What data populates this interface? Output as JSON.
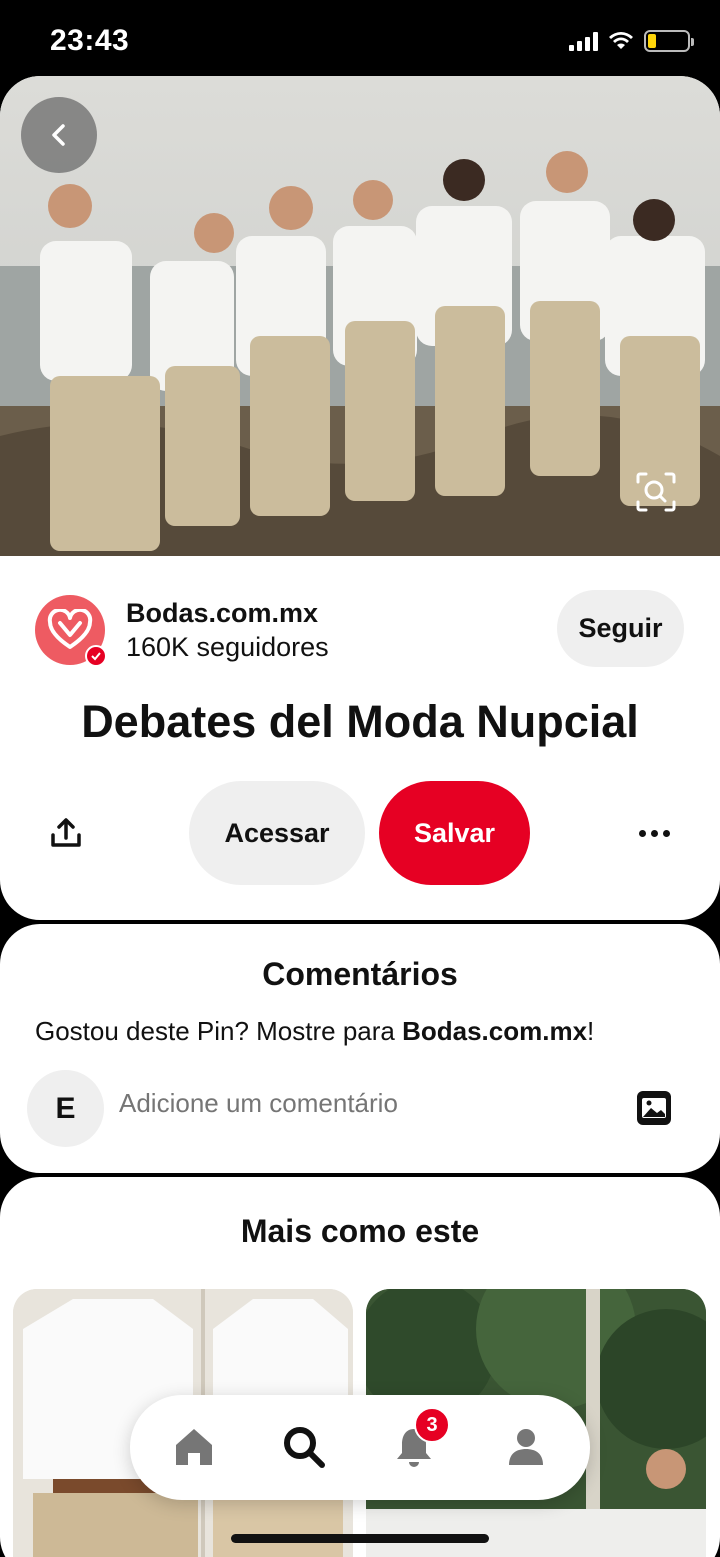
{
  "status_bar": {
    "time": "23:43"
  },
  "pin": {
    "creator": {
      "name": "Bodas.com.mx",
      "followers": "160K seguidores"
    },
    "follow_label": "Seguir",
    "title": "Debates del Moda Nupcial",
    "visit_label": "Acessar",
    "save_label": "Salvar"
  },
  "comments": {
    "title": "Comentários",
    "prompt_prefix": "Gostou deste Pin? Mostre para ",
    "prompt_creator": "Bodas.com.mx",
    "prompt_suffix": "!",
    "user_initial": "E",
    "input_placeholder": "Adicione um comentário"
  },
  "more_like_this": {
    "title": "Mais como este"
  },
  "nav": {
    "items": [
      "home-icon",
      "search-icon",
      "bell-icon",
      "profile-icon"
    ],
    "notifications_badge": "3"
  },
  "colors": {
    "accent": "#e60023",
    "avatar": "#ee5b62",
    "pill": "#efefef"
  }
}
